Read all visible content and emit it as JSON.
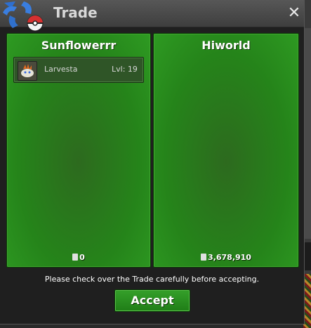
{
  "window": {
    "title": "Trade"
  },
  "left_panel": {
    "player_name": "Sunflowerrr",
    "items": [
      {
        "name": "Larvesta",
        "level": "Lvl: 19",
        "icon": "larvesta-sprite-icon"
      }
    ],
    "money": "0"
  },
  "right_panel": {
    "player_name": "Hiworld",
    "items": [],
    "money": "3,678,910"
  },
  "footer": {
    "notice": "Please check over the Trade carefully before accepting.",
    "accept_label": "Accept"
  },
  "colors": {
    "panel_green": "#25841a",
    "button_green": "#2a8f20",
    "title_bar": "#4a4a4a",
    "background": "#1f1f1f"
  }
}
